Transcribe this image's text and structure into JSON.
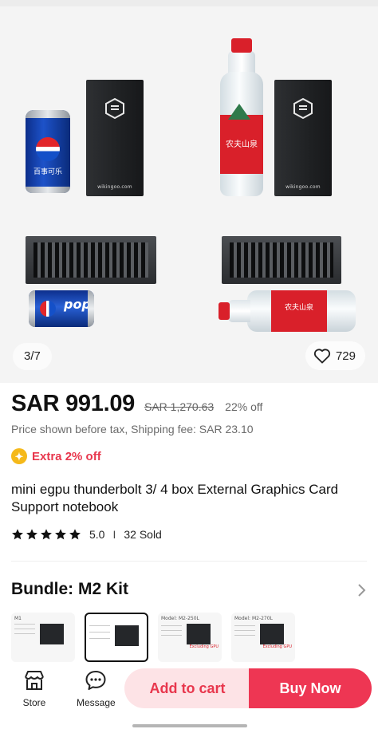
{
  "gallery": {
    "counter": "3/7",
    "likes": "729",
    "box_brand": "wikingoo.com",
    "can_text": "百事可乐",
    "bottle_text": "农夫山泉",
    "can_side_text": "pop"
  },
  "price": {
    "current": "SAR 991.09",
    "original": "SAR 1,270.63",
    "discount": "22% off",
    "tax_note": "Price shown before tax, Shipping fee: SAR 23.10",
    "extra_offer": "Extra 2% off"
  },
  "product": {
    "title": "mini egpu thunderbolt 3/ 4 box External Graphics Card Support notebook",
    "rating": "5.0",
    "rating_sep": "I",
    "sold": "32 Sold",
    "star_count": 5
  },
  "bundle": {
    "title": "Bundle: M2 Kit",
    "thumbs": [
      {
        "label": "M1",
        "red": ""
      },
      {
        "label": "",
        "red": ""
      },
      {
        "label": "Model: M2-250L",
        "red": "Excluding GPU"
      },
      {
        "label": "Model: M2-270L",
        "red": "Excluding GPU"
      }
    ]
  },
  "bottom_bar": {
    "store_label": "Store",
    "message_label": "Message",
    "add_to_cart": "Add to cart",
    "buy_now": "Buy Now"
  },
  "colors": {
    "accent": "#ee3653",
    "accent_light": "#fde3e6",
    "extra_icon": "#f5b91a"
  }
}
